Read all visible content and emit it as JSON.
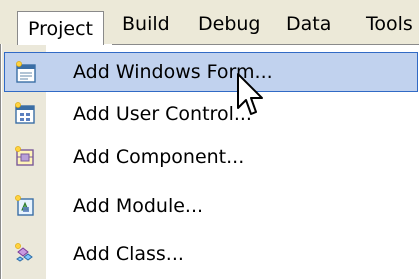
{
  "menubar": {
    "items": [
      {
        "label": "Project"
      },
      {
        "label": "Build"
      },
      {
        "label": "Debug"
      },
      {
        "label": "Data"
      },
      {
        "label": "Tools"
      }
    ]
  },
  "dropdown": {
    "items": [
      {
        "label": "Add Windows Form...",
        "icon": "windows-form-icon",
        "highlighted": true
      },
      {
        "label": "Add User Control...",
        "icon": "user-control-icon"
      },
      {
        "label": "Add Component...",
        "icon": "component-icon"
      },
      {
        "label": "Add Module...",
        "icon": "module-icon"
      },
      {
        "label": "Add Class...",
        "icon": "class-icon"
      }
    ]
  },
  "colors": {
    "menubar_bg": "#ece9d8",
    "highlight_bg": "#c1d2ee",
    "highlight_border": "#316ac5",
    "icon_strip_bg": "#ebe8da"
  }
}
